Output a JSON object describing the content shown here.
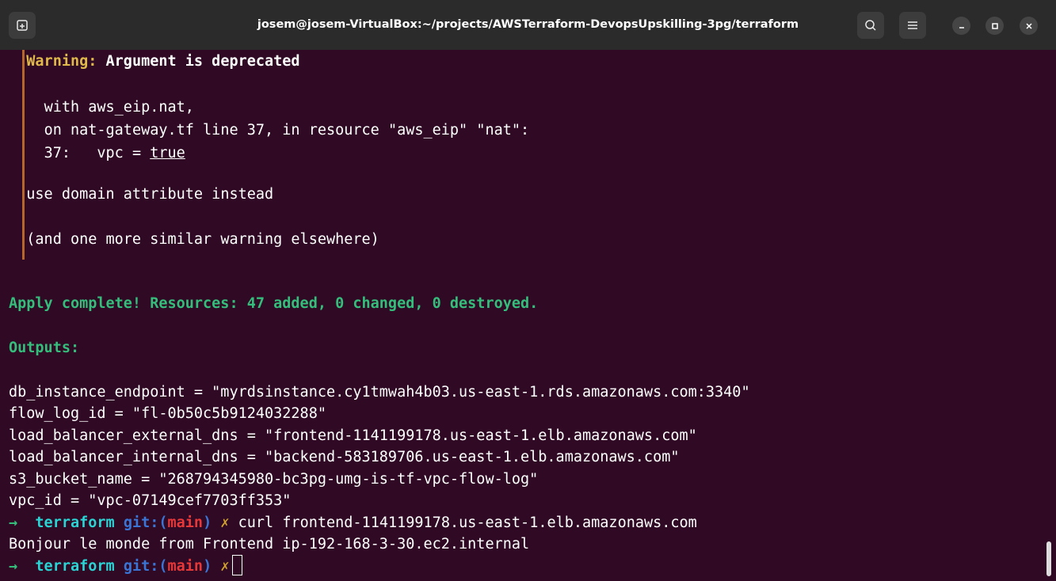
{
  "window": {
    "title": "josem@josem-VirtualBox:~/projects/AWSTerraform-DevopsUpskilling-3pg/terraform",
    "icons": {
      "new_tab": "new-tab-icon",
      "search": "search-icon",
      "menu": "hamburger-menu-icon",
      "minimize": "minimize-icon",
      "maximize": "maximize-icon",
      "close": "close-icon"
    }
  },
  "colors": {
    "background": "#300a24",
    "titlebar": "#2b2b2b",
    "warning": "#e0b94d",
    "success": "#34bd7b",
    "prompt_dir": "#2ad4d4",
    "git_label": "#3a75d6",
    "git_branch": "#e63838"
  },
  "warning": {
    "label": "Warning:",
    "title": "Argument is deprecated",
    "with_line": "with aws_eip.nat,",
    "on_line": "on nat-gateway.tf line 37, in resource \"aws_eip\" \"nat\":",
    "code_num": "37:",
    "code_prefix": "vpc = ",
    "code_value": "true",
    "detail": "use domain attribute instead",
    "more": "(and one more similar warning elsewhere)"
  },
  "apply": "Apply complete! Resources: 47 added, 0 changed, 0 destroyed.",
  "outputs_label": "Outputs:",
  "outputs": [
    "db_instance_endpoint = \"myrdsinstance.cy1tmwah4b03.us-east-1.rds.amazonaws.com:3340\"",
    "flow_log_id = \"fl-0b50c5b9124032288\"",
    "load_balancer_external_dns = \"frontend-1141199178.us-east-1.elb.amazonaws.com\"",
    "load_balancer_internal_dns = \"backend-583189706.us-east-1.elb.amazonaws.com\"",
    "s3_bucket_name = \"268794345980-bc3pg-umg-is-tf-vpc-flow-log\"",
    "vpc_id = \"vpc-07149cef7703ff353\""
  ],
  "prompt": {
    "arrow": "→",
    "dir": "terraform",
    "git": "git:(",
    "branch": "main",
    "close": ")",
    "dirty": "✗"
  },
  "command": "curl frontend-1141199178.us-east-1.elb.amazonaws.com",
  "response": "Bonjour le monde from Frontend ip-192-168-3-30.ec2.internal"
}
